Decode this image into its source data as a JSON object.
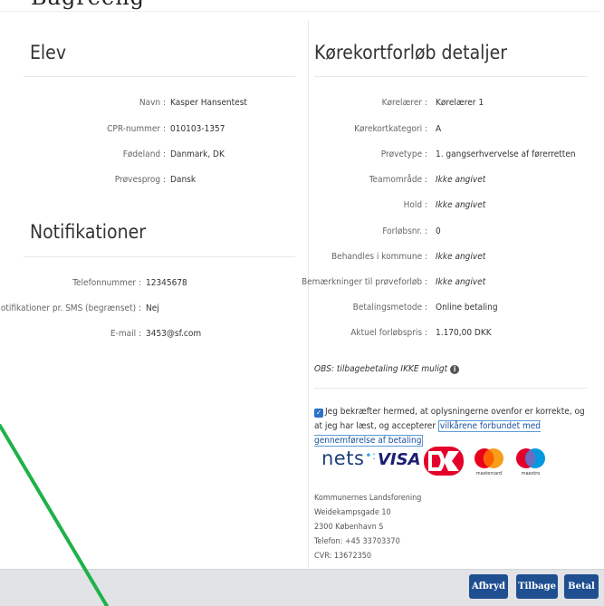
{
  "topstrip": {
    "text": "Bagreeng"
  },
  "elev": {
    "title": "Elev",
    "rows": [
      {
        "label": "Navn :",
        "value": "Kasper Hansentest"
      },
      {
        "label": "CPR-nummer :",
        "value": "010103-1357"
      },
      {
        "label": "Fødeland :",
        "value": "Danmark, DK"
      },
      {
        "label": "Prøvesprog :",
        "value": "Dansk"
      }
    ]
  },
  "notifikationer": {
    "title": "Notifikationer",
    "rows": [
      {
        "label": "Telefonnummer :",
        "value": "12345678"
      },
      {
        "label": "Notifikationer pr. SMS (begrænset) :",
        "value": "Nej"
      },
      {
        "label": "E-mail :",
        "value": "3453@sf.com"
      }
    ]
  },
  "detaljer": {
    "title": "Kørekortforløb detaljer",
    "rows": [
      {
        "label": "Kørelærer :",
        "value": "Kørelærer 1"
      },
      {
        "label": "Kørekortkategori :",
        "value": "A"
      },
      {
        "label": "Prøvetype :",
        "value": "1. gangserhvervelse af førerretten"
      },
      {
        "label": "Teamområde :",
        "value": "Ikke angivet"
      },
      {
        "label": "Hold :",
        "value": "Ikke angivet"
      },
      {
        "label": "Forløbsnr. :",
        "value": "0"
      },
      {
        "label": "Behandles i kommune :",
        "value": "Ikke angivet"
      },
      {
        "label": "Bemærkninger til prøveforløb :",
        "value": "Ikke angivet"
      },
      {
        "label": "Betalingsmetode :",
        "value": "Online betaling"
      },
      {
        "label": "Aktuel forløbspris :",
        "value": "1.170,00 DKK"
      }
    ],
    "obs": "OBS: tilbagebetaling IKKE muligt",
    "consent_text": "Jeg bekræfter hermed, at oplysningerne ovenfor er korrekte, og at jeg har læst, og accepterer",
    "consent_link": "vilkårene forbundet med gennemførelse af betaling",
    "consent_checked": true
  },
  "logos": {
    "nets": "nets",
    "visa": "VISA",
    "mastercard": "mastercard",
    "maestro": "maestro"
  },
  "address": {
    "line1": "Kommunernes Landsforening",
    "line2": "Weidekampsgade 10",
    "line3": "2300 København S",
    "line4": "Telefon: +45 33703370",
    "line5": "CVR: 13672350"
  },
  "buttons": {
    "cancel": "Afbryd",
    "back": "Tilbage",
    "pay": "Betal"
  },
  "colors": {
    "primary_button": "#1f4f91",
    "checkbox": "#2b73c7",
    "footer_bg": "#e1e3e6",
    "annotation_line": "#1fb24a"
  }
}
